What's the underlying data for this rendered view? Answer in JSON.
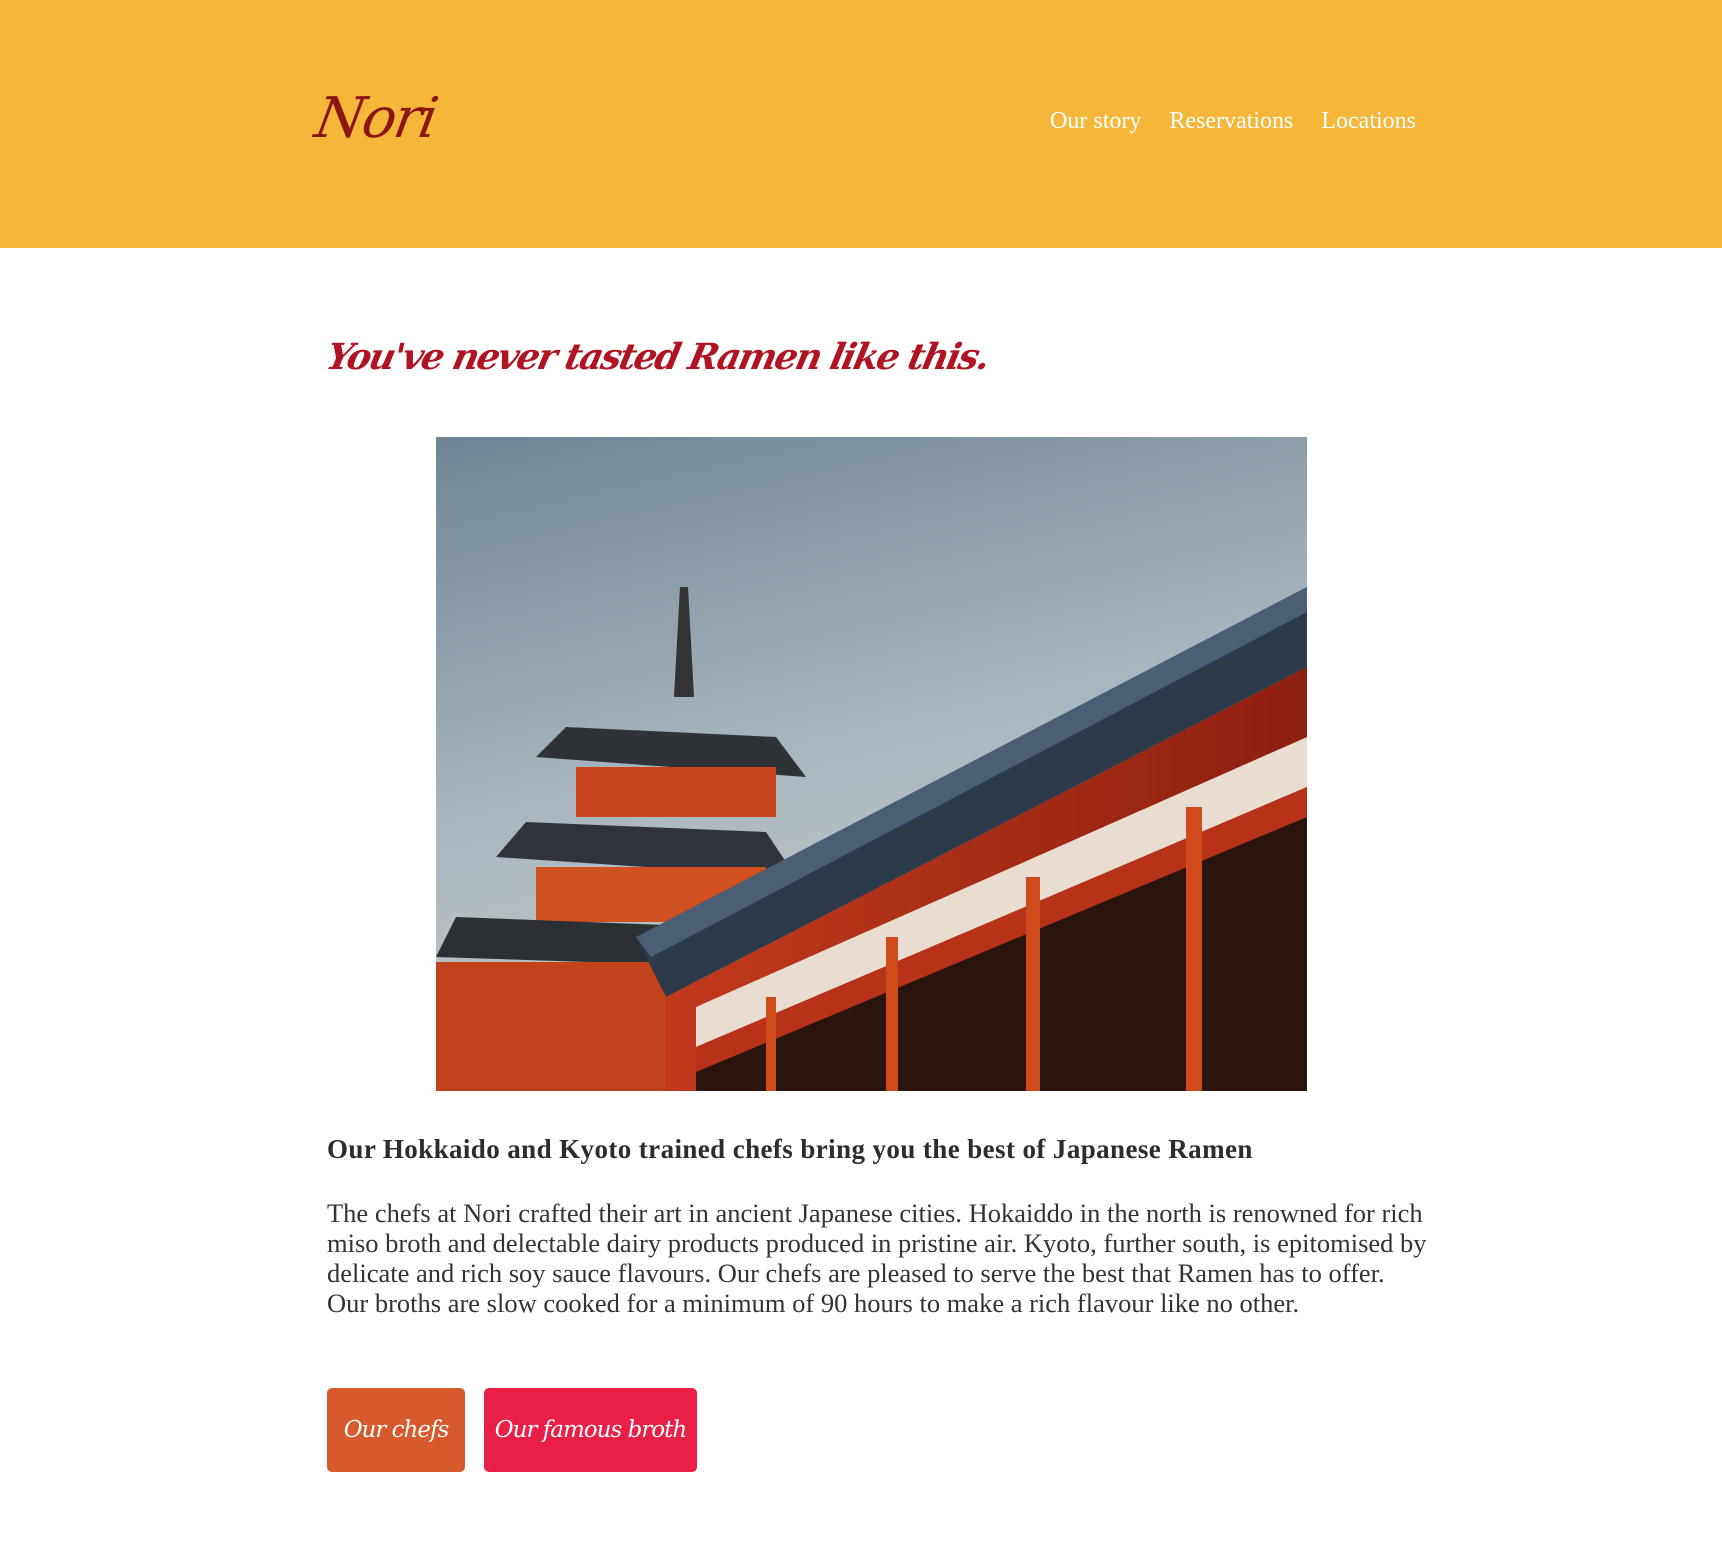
{
  "header": {
    "logo": "Nori",
    "nav": [
      "Our story",
      "Reservations",
      "Locations"
    ]
  },
  "main": {
    "headline": "You've never tasted Ramen like this.",
    "subheading": "Our Hokkaido and Kyoto trained chefs bring you the best of Japanese Ramen",
    "body": "The chefs at Nori crafted their art in ancient Japanese cities. Hokaiddo in the north is renowned for rich miso broth and delectable dairy products produced in pristine air. Kyoto, further south, is epitomised by delicate and rich soy sauce flavours. Our chefs are pleased to serve the best that Ramen has to offer. Our broths are slow cooked for a minimum of 90 hours to make a rich flavour like no other.",
    "buttons": [
      "Our chefs",
      "Our famous broth"
    ]
  },
  "colors": {
    "header_bg": "#f5b639",
    "logo": "#8c1512",
    "headline": "#b01423",
    "btn_chefs": "#d65a2b",
    "btn_broth": "#ea1f45"
  }
}
